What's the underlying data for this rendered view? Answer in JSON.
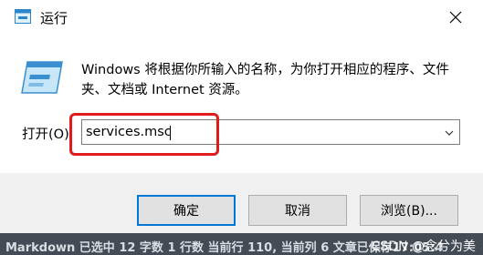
{
  "window": {
    "title": "运行",
    "icon": "run-app-icon",
    "close_glyph": "✕"
  },
  "description": {
    "text": "Windows 将根据你所输入的名称，为你打开相应的程序、文件夹、文档或 Internet 资源。"
  },
  "open_field": {
    "label": "打开(O):",
    "value": "services.msc"
  },
  "buttons": {
    "ok_label": "确定",
    "cancel_label": "取消",
    "browse_label": "浏览(B)..."
  },
  "statusbar": {
    "text": "Markdown 已选中  12 字数  1 行数  当前行 110, 当前列 6  文章已保存17:05:4",
    "watermark": "CSDN @念兮为美"
  },
  "colors": {
    "highlight": "#e11b1b",
    "focus_border": "#0078d7",
    "button_bar_bg": "#f0f0f0",
    "statusbar_bg": "#434c55"
  }
}
